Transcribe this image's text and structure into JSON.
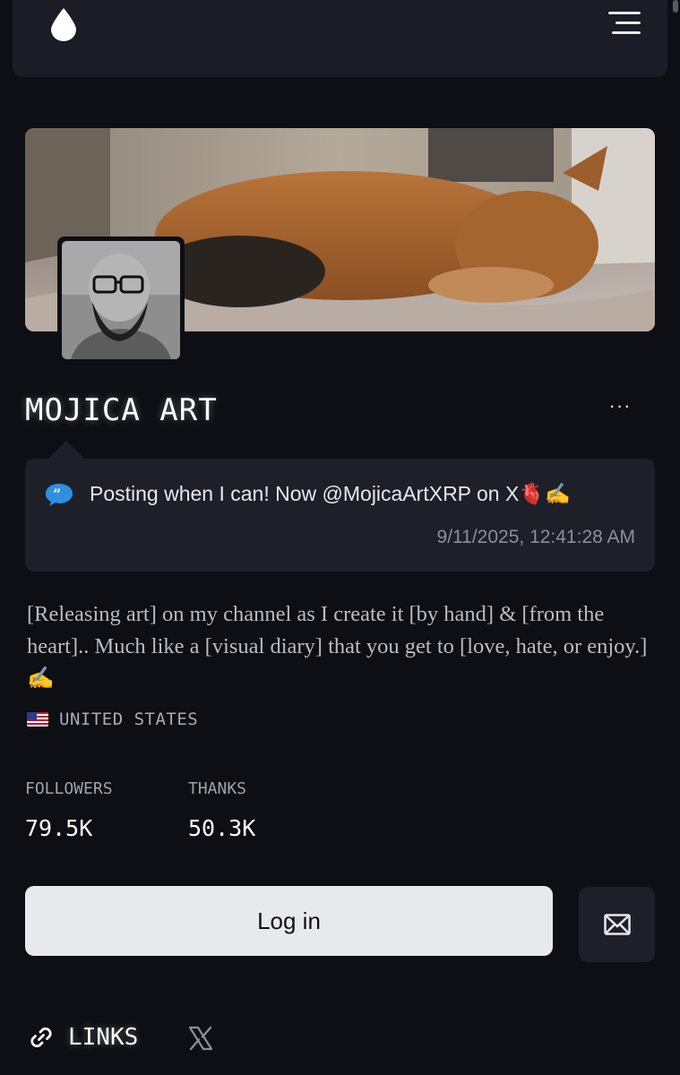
{
  "header": {
    "logo_icon": "droplet-icon",
    "menu_icon": "hamburger-menu-icon"
  },
  "profile": {
    "banner_image": "sleeping-dog-photo",
    "avatar_image": "bearded-man-glasses-photo",
    "name": "MOJICA ART",
    "more_label": "···"
  },
  "status": {
    "icon": "speech-bubble-quote-icon",
    "text": "Posting when I can! Now @MojicaArtXRP on X🫀✍️",
    "timestamp": "9/11/2025, 12:41:28 AM"
  },
  "bio": "[Releasing art] on my channel as I create it [by hand] & [from the heart].. Much like a [visual diary] that you get to [love, hate, or enjoy.]✍️",
  "location": {
    "flag_icon": "us-flag-icon",
    "text": "UNITED STATES"
  },
  "stats": {
    "followers_label": "FOLLOWERS",
    "followers_value": "79.5K",
    "thanks_label": "THANKS",
    "thanks_value": "50.3K"
  },
  "actions": {
    "login_label": "Log in",
    "mail_icon": "envelope-icon"
  },
  "links": {
    "label": "LINKS",
    "link_icon": "chain-link-icon",
    "x_icon": "x-logo-icon"
  },
  "colors": {
    "background": "#0d0f14",
    "card": "#1d2029",
    "accent_quote": "#2f8fe0",
    "button_light": "#e8e9ed"
  }
}
